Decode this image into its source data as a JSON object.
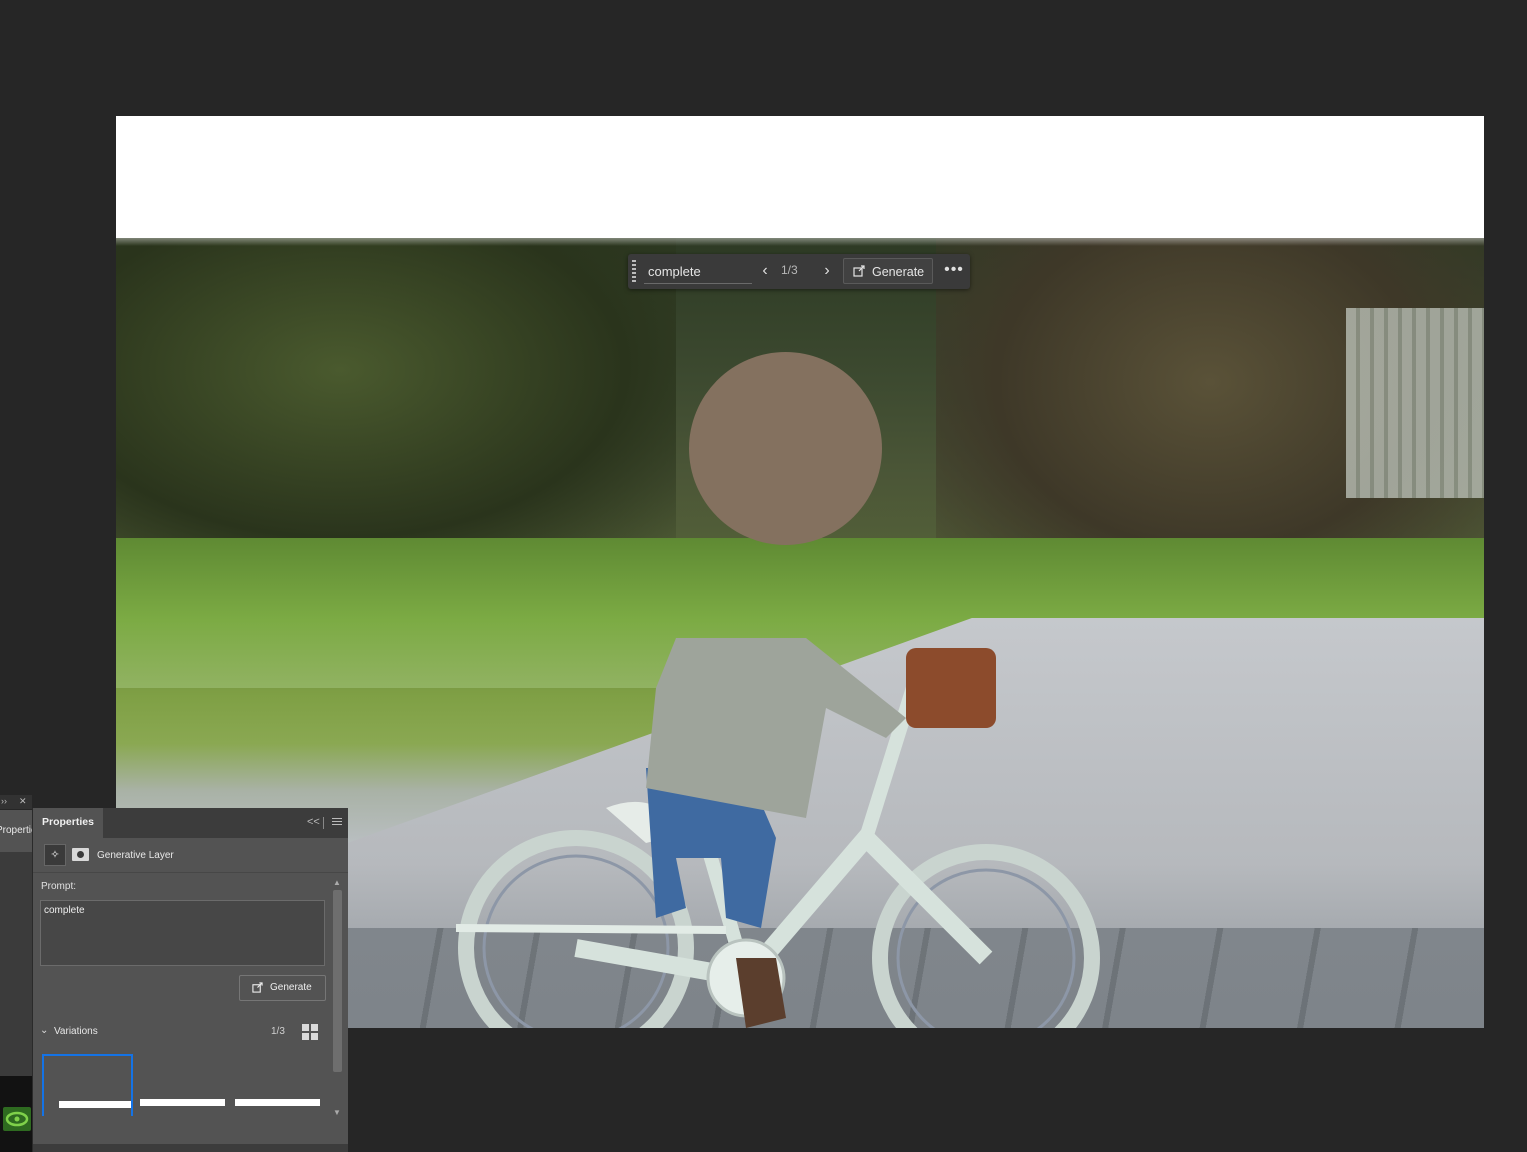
{
  "contextual_taskbar": {
    "prompt_value": "complete",
    "prev_icon": "chevron-left-icon",
    "next_icon": "chevron-right-icon",
    "variation_counter": "1/3",
    "generate_label": "Generate",
    "more_icon": "ellipsis-icon"
  },
  "dock": {
    "collapsed_tab_label": "Properties"
  },
  "properties_panel": {
    "tab_label": "Properties",
    "layer_type": "Generative Layer",
    "prompt_label": "Prompt:",
    "prompt_value": "complete",
    "generate_label": "Generate",
    "variations_label": "Variations",
    "variations_count": "1/3",
    "variation_count": 3,
    "selected_variation": 1
  },
  "colors": {
    "app_background": "#262626",
    "panel_background": "#535353",
    "selection_accent": "#1473e6"
  }
}
